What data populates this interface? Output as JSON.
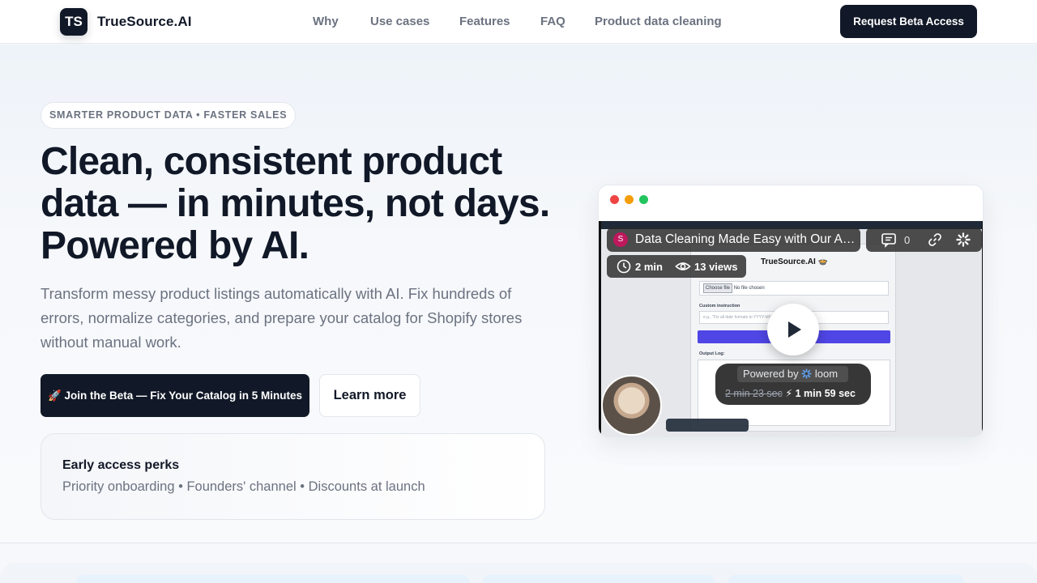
{
  "header": {
    "logo_initials": "TS",
    "brand": "TrueSource.AI",
    "nav": [
      {
        "label": "Why"
      },
      {
        "label": "Use cases"
      },
      {
        "label": "Features"
      },
      {
        "label": "FAQ"
      },
      {
        "label": "Product data cleaning"
      }
    ],
    "cta": "Request Beta Access"
  },
  "hero": {
    "eyebrow": "SMARTER PRODUCT DATA • FASTER SALES",
    "title": "Clean, consistent product data — in minutes, not days. Powered by AI.",
    "subtitle": "Transform messy product listings automatically with AI. Fix hundreds of errors, normalize categories, and prepare your catalog for Shopify stores without manual work.",
    "primary_button": "🚀 Join the Beta — Fix Your Catalog in 5 Minutes",
    "secondary_button": "Learn more",
    "perks": {
      "title": "Early access perks",
      "text": "Priority onboarding • Founders' channel • Discounts at launch"
    }
  },
  "video": {
    "avatar_letter": "S",
    "title": "Data Cleaning Made Easy with Our AI Tool",
    "comment_count": "0",
    "duration": "2 min",
    "views": "13 views",
    "inner_logo": "TrueSource.AI 🍲",
    "inner_file_button": "Choose file",
    "inner_file_status": "No file chosen",
    "inner_custom_label": "Custom instruction",
    "inner_placeholder": "e.g., \"Fix all date formats to YYYY-MM-DD\"",
    "inner_output_label": "Output Log:",
    "powered_by": "Powered by",
    "powered_brand": "loom",
    "time_original": "2 min 23 sec",
    "time_fast": "⚡ 1 min 59 sec"
  },
  "colors": {
    "primary_dark": "#111827",
    "muted_text": "#6b7280",
    "accent_purple": "#4f46e5"
  }
}
